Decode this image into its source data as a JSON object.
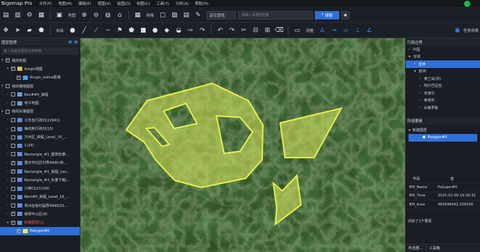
{
  "app": {
    "title": "Bigemap Pro"
  },
  "menu": [
    "文件(F)",
    "地图(M)",
    "编辑(E)",
    "视图(V)",
    "绘图(D)",
    "制图(C)",
    "工具(T)",
    "分析(A)",
    "帮助(H)"
  ],
  "toolbar1": {
    "map_label": "地图",
    "grid_label": "网格",
    "locate_select": "定位查找",
    "search_placeholder": "请输入关键字检索",
    "search_button": "搜索"
  },
  "toolbar2": {
    "draw_label": "标绘",
    "measure_label": "测量",
    "tasks_label": "任务列表"
  },
  "layer_panel": {
    "title": "图层管理",
    "search_placeholder": "输入关键字图层名称搜索",
    "items": [
      {
        "label": "我的地图",
        "level": 0,
        "arrow": "▾",
        "checked": true,
        "icon": "none"
      },
      {
        "label": "Arcgis地图",
        "level": 1,
        "arrow": "▾",
        "checked": true,
        "icon": "folder"
      },
      {
        "label": "Arcgis_online影像",
        "level": 2,
        "arrow": "",
        "checked": true,
        "icon": "img"
      },
      {
        "label": "我的栅格图层",
        "level": 0,
        "arrow": "▾",
        "checked": false,
        "icon": "none"
      },
      {
        "label": "Bec##0_高程",
        "level": 1,
        "arrow": "›",
        "checked": false,
        "icon": "raster"
      },
      {
        "label": "电子地图",
        "level": 1,
        "arrow": "›",
        "checked": false,
        "icon": "raster"
      },
      {
        "label": "我的矢量图层",
        "level": 0,
        "arrow": "▾",
        "checked": false,
        "icon": "none"
      },
      {
        "label": "江苏省行政村(22841)",
        "level": 1,
        "arrow": "›",
        "checked": false,
        "icon": "vec"
      },
      {
        "label": "梅花新行政村(15)",
        "level": 1,
        "arrow": "›",
        "checked": false,
        "icon": "vec"
      },
      {
        "label": "万州区_高程_Level_16_...",
        "level": 1,
        "arrow": "›",
        "checked": false,
        "icon": "vec"
      },
      {
        "label": "1(34)",
        "level": 1,
        "arrow": "›",
        "checked": false,
        "icon": "vec"
      },
      {
        "label": "Rectangle_#1_建筑轮廓...",
        "level": 1,
        "arrow": "›",
        "checked": false,
        "icon": "vec"
      },
      {
        "label": "重庆市社区村界4490-统...",
        "level": 1,
        "arrow": "›",
        "checked": true,
        "icon": "vec"
      },
      {
        "label": "Rectangle_#1_高程_Lev...",
        "level": 1,
        "arrow": "›",
        "checked": true,
        "icon": "vec"
      },
      {
        "label": "Rectangle_#3_矢量下载(...",
        "level": 1,
        "arrow": "›",
        "checked": false,
        "icon": "vec"
      },
      {
        "label": "江西CJ(21109)",
        "level": 1,
        "arrow": "›",
        "checked": false,
        "icon": "vec"
      },
      {
        "label": "Rect#0_高程_Level_16_...",
        "level": 1,
        "arrow": "›",
        "checked": false,
        "icon": "vec"
      },
      {
        "label": "贵州省各村届界4490(51...",
        "level": 1,
        "arrow": "›",
        "checked": false,
        "icon": "vec"
      },
      {
        "label": "荥阳中山区(8)",
        "level": 1,
        "arrow": "›",
        "checked": true,
        "icon": "vec"
      },
      {
        "label": "新建图层(1)",
        "level": 1,
        "arrow": "▾",
        "checked": true,
        "icon": "vec",
        "accent": true
      },
      {
        "label": "Polygon#0",
        "level": 2,
        "arrow": "",
        "checked": true,
        "icon": "poly",
        "selected": true
      }
    ]
  },
  "region_panel": {
    "title": "行政边界",
    "items": [
      {
        "label": "中国",
        "level": 0,
        "arrow": "›"
      },
      {
        "label": "全球",
        "level": 0,
        "arrow": "▾"
      },
      {
        "label": "亚洲",
        "level": 1,
        "arrow": "›",
        "selected": true
      },
      {
        "label": "欧洲",
        "level": 1,
        "arrow": "▾"
      },
      {
        "label": "奥兰岛(芬)",
        "level": 2,
        "arrow": "›"
      },
      {
        "label": "阿尔巴尼亚",
        "level": 2,
        "arrow": "›"
      },
      {
        "label": "安道尔",
        "level": 2,
        "arrow": "›"
      },
      {
        "label": "奥地利",
        "level": 2,
        "arrow": "›"
      },
      {
        "label": "白俄罗斯",
        "level": 2,
        "arrow": "›"
      }
    ]
  },
  "features_panel": {
    "title": "所选要素",
    "layer": "新建图层",
    "feature": "Polygon#0"
  },
  "attributes": {
    "headers": [
      "字段",
      "值"
    ],
    "rows": [
      {
        "k": "BM_Name",
        "v": "Polygon#0"
      },
      {
        "k": "BM_Time",
        "v": "2025-01-09 16:36:31"
      },
      {
        "k": "BM_Area",
        "v": "485648442.238356"
      }
    ],
    "footer": "识别了1个要素"
  },
  "bottom_tabs": [
    "所选要...",
    "工具箱"
  ],
  "colors": {
    "accent": "#2f6fd8",
    "polygon_stroke": "#e8f24a",
    "polygon_fill": "#d8e85a"
  }
}
